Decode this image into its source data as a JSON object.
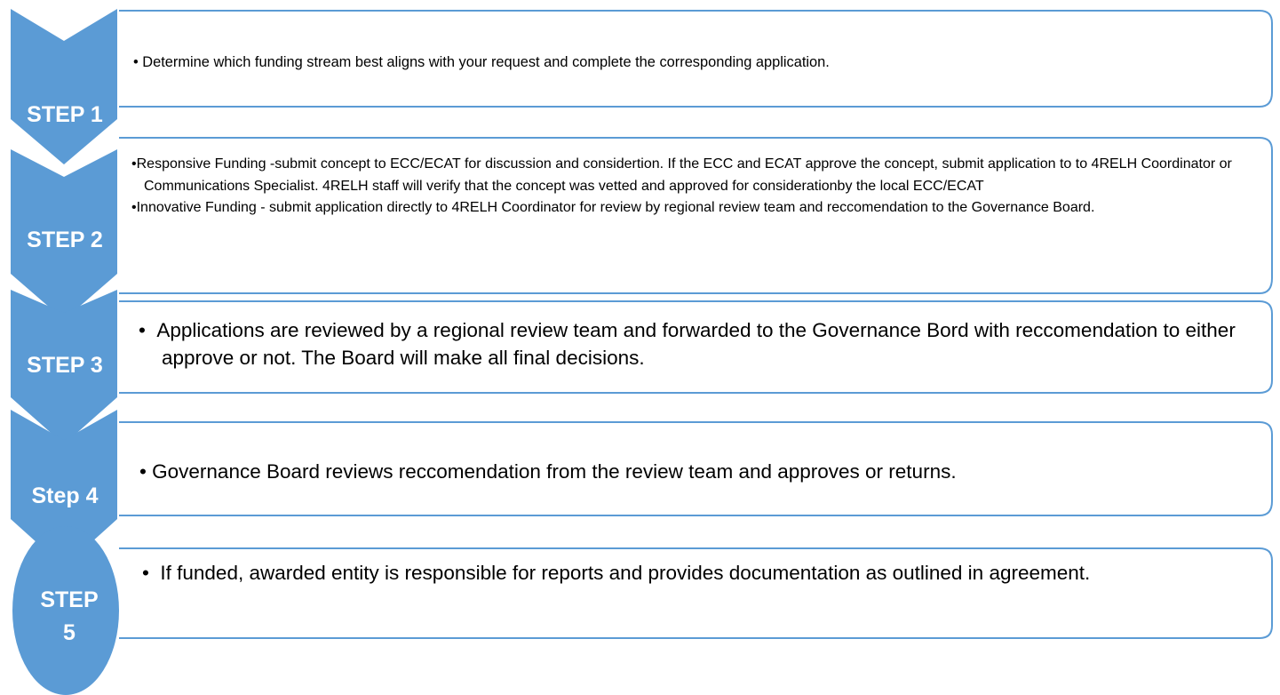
{
  "colors": {
    "chevron_fill": "#5b9bd5",
    "box_border": "#5b9bd5",
    "label_text": "#ffffff"
  },
  "steps": [
    {
      "label": "STEP 1",
      "bullets": [
        "Determine which funding stream best aligns with your request and complete the corresponding application."
      ]
    },
    {
      "label": "STEP 2",
      "bullets": [
        "Responsive Funding -submit concept to ECC/ECAT for discussion and considertion.  If the ECC and ECAT approve the concept, submit application to to 4RELH Coordinator or Communications Specialist. 4RELH staff will verify that the concept was vetted and approved for considerationby the local ECC/ECAT",
        "Innovative Funding - submit application directly to 4RELH Coordinator for review by regional review team and reccomendation to the Governance Board."
      ]
    },
    {
      "label": "STEP 3",
      "bullets": [
        "Applications are reviewed by a regional review team and forwarded to the Governance Bord with reccomendation to either approve or not. The Board will make all final decisions."
      ]
    },
    {
      "label": "Step 4",
      "bullets": [
        "Governance Board reviews reccomendation from the review team and approves or returns."
      ]
    },
    {
      "label_line1": "STEP",
      "label_line2": "5",
      "bullets": [
        " If funded, awarded entity is responsible for reports and provides documentation as outlined in agreement."
      ]
    }
  ]
}
